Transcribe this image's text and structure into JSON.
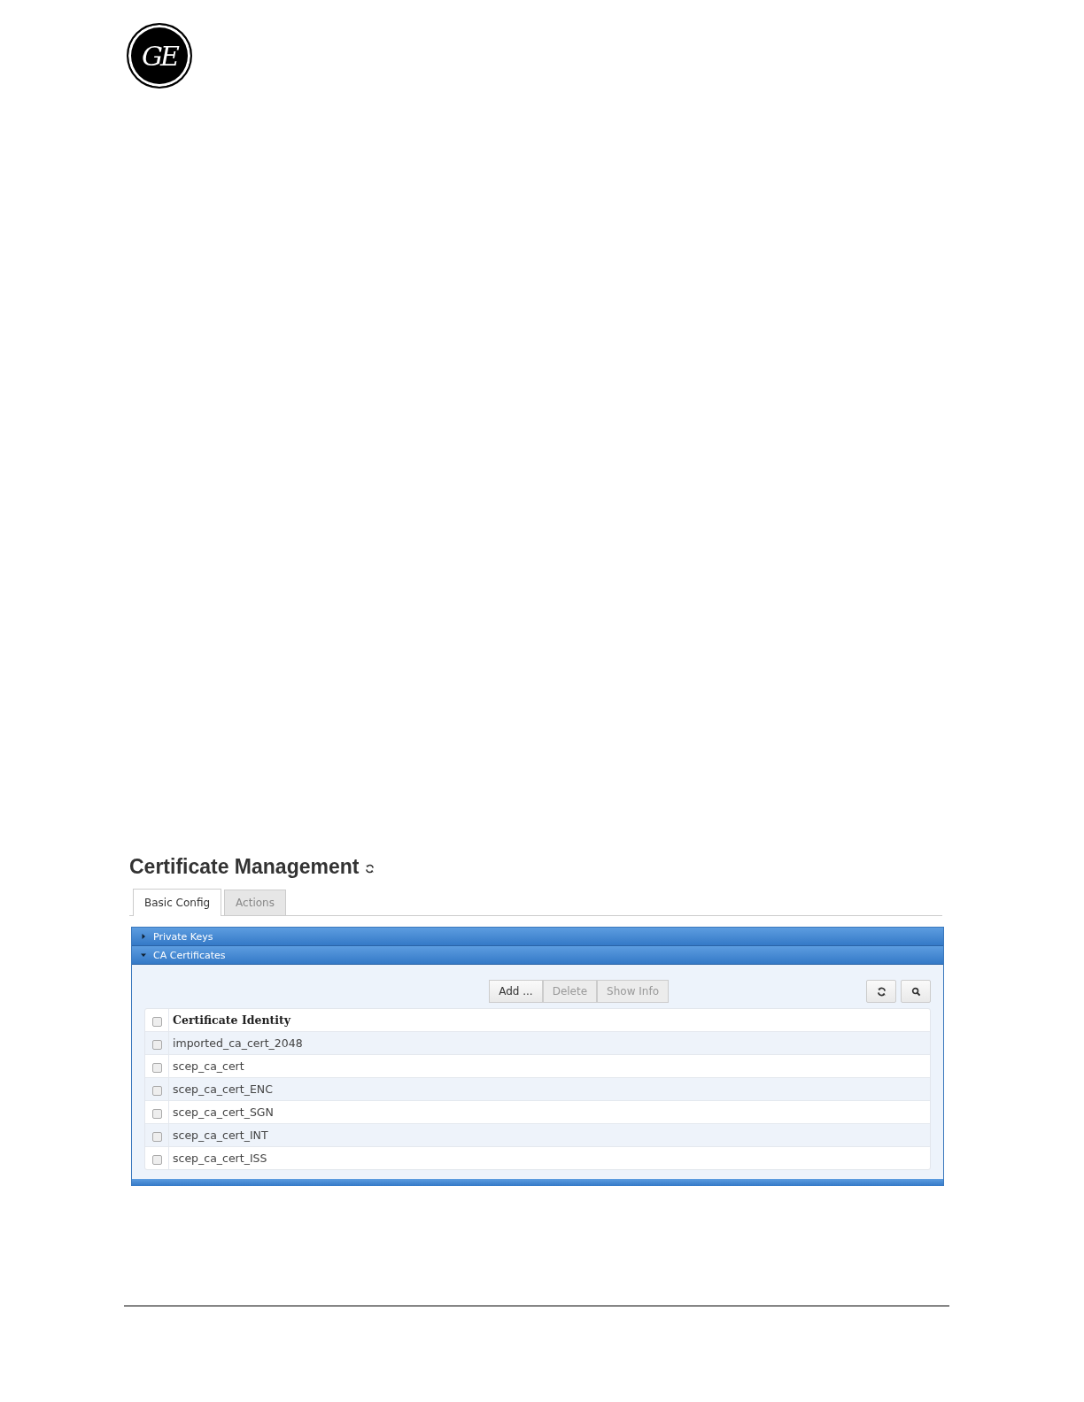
{
  "logo": {
    "text": "GE"
  },
  "title": "Certificate Management",
  "tabs": [
    {
      "label": "Basic Config",
      "selected": true
    },
    {
      "label": "Actions",
      "selected": false
    }
  ],
  "sections": [
    {
      "title": "Private Keys",
      "expanded": false
    },
    {
      "title": "CA Certificates",
      "expanded": true
    }
  ],
  "toolbar": {
    "buttons": [
      {
        "label": "Add ...",
        "disabled": false
      },
      {
        "label": "Delete",
        "disabled": true
      },
      {
        "label": "Show Info",
        "disabled": true
      }
    ]
  },
  "table": {
    "header": {
      "label": "Certificate Identity",
      "checked": false
    },
    "rows": [
      {
        "label": "imported_ca_cert_2048",
        "checked": false
      },
      {
        "label": "scep_ca_cert",
        "checked": false
      },
      {
        "label": "scep_ca_cert_ENC",
        "checked": false
      },
      {
        "label": "scep_ca_cert_SGN",
        "checked": false
      },
      {
        "label": "scep_ca_cert_INT",
        "checked": false
      },
      {
        "label": "scep_ca_cert_ISS",
        "checked": false
      }
    ]
  }
}
